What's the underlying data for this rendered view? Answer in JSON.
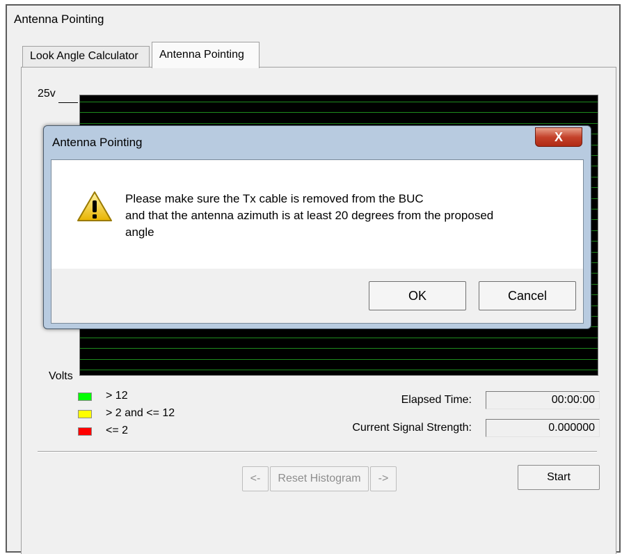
{
  "window": {
    "title": "Antenna Pointing"
  },
  "tabs": [
    {
      "label": "Look Angle Calculator"
    },
    {
      "label": "Antenna Pointing"
    }
  ],
  "graph": {
    "y_max_label": "25v",
    "y_axis_label": "Volts",
    "background": "#000000",
    "gridline_color": "#1e8c1e"
  },
  "legend": [
    {
      "label": "> 12",
      "color": "#00ff00"
    },
    {
      "label": "> 2 and <= 12",
      "color": "#ffff00"
    },
    {
      "label": "<= 2",
      "color": "#ff0000"
    }
  ],
  "fields": {
    "elapsed_time": {
      "label": "Elapsed Time:",
      "value": "00:00:00"
    },
    "signal_strength": {
      "label": "Current Signal Strength:",
      "value": "0.000000"
    }
  },
  "buttons": {
    "prev": "<-",
    "reset": "Reset Histogram",
    "next": "->",
    "start": "Start"
  },
  "dialog": {
    "title": "Antenna Pointing",
    "close_label": "X",
    "icon": "warning-icon",
    "message": "Please make sure the Tx cable is removed from the BUC\n and that the antenna azimuth is at least 20 degrees from the proposed\nangle",
    "ok_label": "OK",
    "cancel_label": "Cancel"
  }
}
